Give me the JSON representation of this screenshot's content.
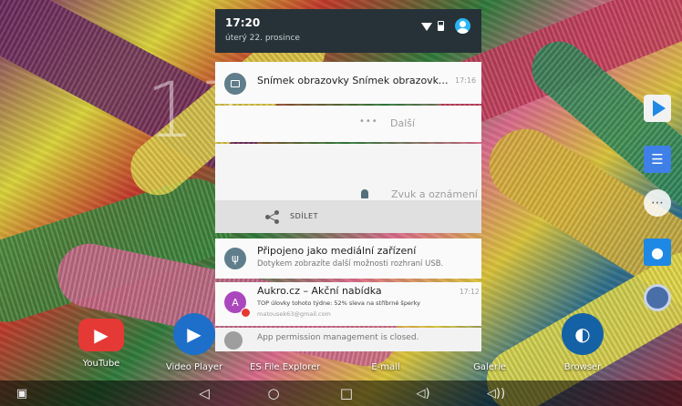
{
  "status_bar": {
    "time": "17:20",
    "date": "úterý 22. prosince"
  },
  "background": {
    "clock": "17"
  },
  "notifications": {
    "screenshot": {
      "title": "Snímek obrazovky Snímek obrazovky…",
      "time": "17:16"
    },
    "more": {
      "dots": "•••",
      "label": "Další"
    },
    "sound": {
      "label": "Zvuk a oznámení"
    },
    "share": {
      "label": "SDÍLET"
    },
    "usb": {
      "title": "Připojeno jako mediální zařízení",
      "text": "Dotykem zobrazíte další možnosti rozhraní USB."
    },
    "aukro": {
      "avatar_letter": "A",
      "title": "Aukro.cz – Akční nabídka",
      "time": "17:12",
      "text": "TOP úlovky tohoto týdne: 52% sleva na stříbrné šperky",
      "email": "matousek63@gmail.com"
    },
    "permission": {
      "text": "App permission management is closed."
    }
  },
  "dock": {
    "youtube": "YouTube",
    "video_player": "Video Player",
    "file_explorer": "ES File Explorer",
    "email": "E-mail",
    "gallery": "Galerie",
    "browser": "Browser"
  },
  "icons": {
    "side": [
      "play-store-icon",
      "docs-icon",
      "apps-icon",
      "contacts-icon",
      "camera-icon"
    ],
    "nav": [
      "screenshot-icon",
      "back-icon",
      "home-icon",
      "recent-apps-icon",
      "volume-down-icon",
      "volume-up-icon"
    ]
  },
  "colors": {
    "shade_header": "#263238",
    "card": "#fafafa",
    "accent": "#29b6f6",
    "aukro": "#ab47bc"
  }
}
